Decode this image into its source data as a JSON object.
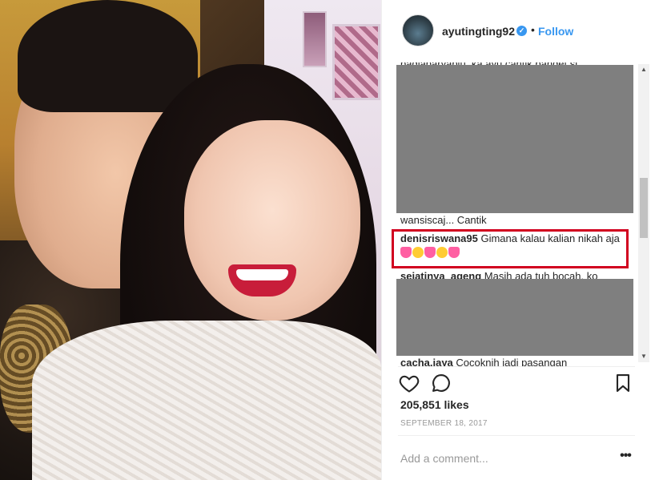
{
  "post": {
    "username": "ayutingting92",
    "verified_icon": "verified-badge-icon",
    "separator": "•",
    "follow_label": "Follow"
  },
  "comments": {
    "clipped_top_text": "pagiaparyapiu_ka ayu cantik banget si",
    "partial_text": "wansiscaj... Cantik",
    "highlighted": {
      "user": "denisriswana95",
      "text": "Gimana kalau kalian nikah aja"
    },
    "after": {
      "user": "sejatinya_ageng",
      "text": "Masih ada tuh bocah. ko"
    },
    "bottom": {
      "user": "cacha.jaya",
      "text": "Cocoknih jadi pasangan"
    }
  },
  "actions": {
    "like_icon": "heart-icon",
    "comment_icon": "comment-icon",
    "save_icon": "bookmark-icon"
  },
  "likes_label": "205,851 likes",
  "date": "SEPTEMBER 18, 2017",
  "add_comment_placeholder": "Add a comment...",
  "more_label": "•••",
  "colors": {
    "accent": "#3897f0",
    "highlight_border": "#d1001f",
    "redacted": "#7f7f7f"
  }
}
